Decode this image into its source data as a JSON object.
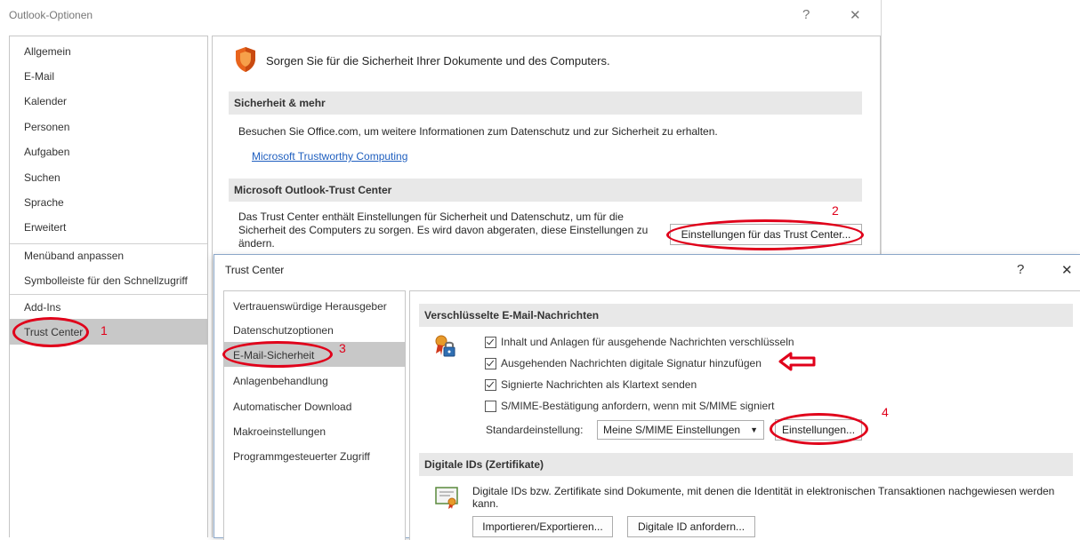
{
  "outlook_options": {
    "title": "Outlook-Optionen",
    "help": "?",
    "close": "✕",
    "sidebar": [
      {
        "label": "Allgemein"
      },
      {
        "label": "E-Mail"
      },
      {
        "label": "Kalender"
      },
      {
        "label": "Personen"
      },
      {
        "label": "Aufgaben"
      },
      {
        "label": "Suchen"
      },
      {
        "label": "Sprache"
      },
      {
        "label": "Erweitert"
      },
      {
        "label": "Menüband anpassen"
      },
      {
        "label": "Symbolleiste für den Schnellzugriff"
      },
      {
        "label": "Add-Ins"
      },
      {
        "label": "Trust Center"
      }
    ],
    "selected": "Trust Center",
    "intro": "Sorgen Sie für die Sicherheit Ihrer Dokumente und des Computers.",
    "section1_title": "Sicherheit & mehr",
    "section1_text": "Besuchen Sie Office.com, um weitere Informationen zum Datenschutz und zur Sicherheit zu erhalten.",
    "section1_link": "Microsoft Trustworthy Computing",
    "section2_title": "Microsoft Outlook-Trust Center",
    "section2_text": "Das Trust Center enthält Einstellungen für Sicherheit und Datenschutz, um für die Sicherheit des Computers zu sorgen. Es wird davon abgeraten, diese Einstellungen zu ändern.",
    "trust_center_button": "Einstellungen für das Trust Center..."
  },
  "trust_center": {
    "title": "Trust Center",
    "help": "?",
    "close": "✕",
    "sidebar": [
      {
        "label": "Vertrauenswürdige Herausgeber"
      },
      {
        "label": "Datenschutzoptionen"
      },
      {
        "label": "E-Mail-Sicherheit"
      },
      {
        "label": "Anlagenbehandlung"
      },
      {
        "label": "Automatischer Download"
      },
      {
        "label": "Makroeinstellungen"
      },
      {
        "label": "Programmgesteuerter Zugriff"
      }
    ],
    "selected": "E-Mail-Sicherheit",
    "encrypted_title": "Verschlüsselte E-Mail-Nachrichten",
    "options": [
      {
        "label": "Inhalt und Anlagen für ausgehende Nachrichten verschlüsseln",
        "checked": true
      },
      {
        "label": "Ausgehenden Nachrichten digitale Signatur hinzufügen",
        "checked": true
      },
      {
        "label": "Signierte Nachrichten als Klartext senden",
        "checked": true
      },
      {
        "label": "S/MIME-Bestätigung anfordern, wenn mit S/MIME signiert",
        "checked": false
      }
    ],
    "default_setting_label": "Standardeinstellung:",
    "default_setting_value": "Meine S/MIME Einstellungen",
    "settings_button": "Einstellungen...",
    "digital_ids_title": "Digitale IDs (Zertifikate)",
    "digital_ids_text": "Digitale IDs bzw. Zertifikate sind Dokumente, mit denen die Identität in elektronischen Transaktionen nachgewiesen werden kann.",
    "import_export_button": "Importieren/Exportieren...",
    "request_id_button": "Digitale ID anfordern..."
  },
  "annotations": {
    "step1": "1",
    "step2": "2",
    "step3": "3",
    "step4": "4",
    "accent_color": "#e0001a"
  }
}
